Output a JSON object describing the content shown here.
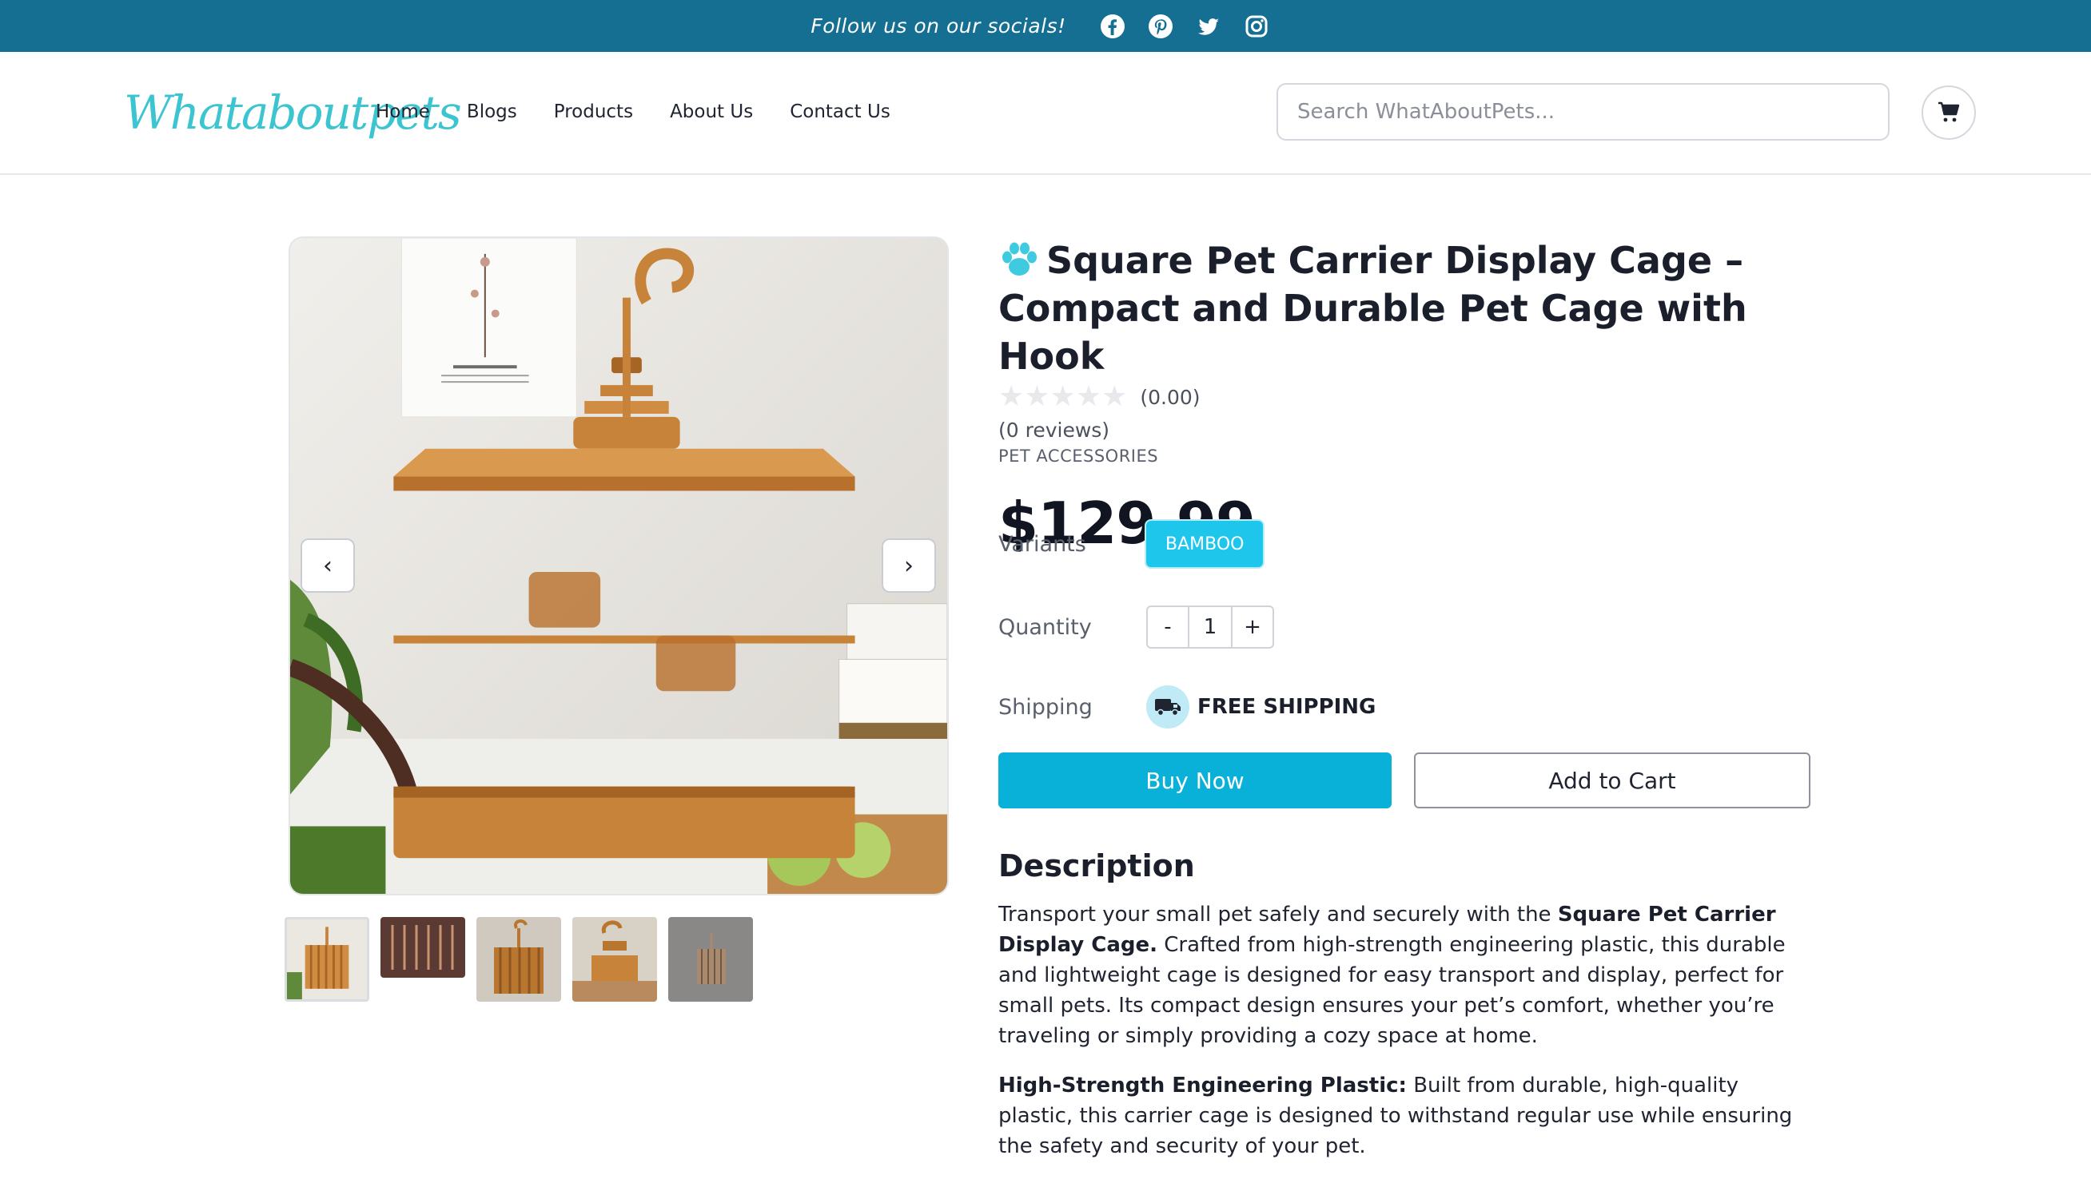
{
  "topbar": {
    "follow_text": "Follow us on our socials!",
    "icons": [
      "facebook-icon",
      "pinterest-icon",
      "twitter-icon",
      "instagram-icon"
    ]
  },
  "header": {
    "logo_text": "Whataboutpets",
    "nav": [
      "Home",
      "Blogs",
      "Products",
      "About Us",
      "Contact Us"
    ],
    "search_placeholder": "Search WhatAboutPets...",
    "cart_icon": "cart-icon"
  },
  "gallery": {
    "prev_label": "‹",
    "next_label": "›",
    "thumbnail_count": 5,
    "active_thumbnail": 1
  },
  "product": {
    "title": "Square Pet Carrier Display Cage – Compact and Durable Pet Cage with Hook",
    "stars": "★★★★★",
    "rating": "(0.00)",
    "reviews": "(0 reviews)",
    "category": "PET ACCESSORIES",
    "price": "$129.99",
    "variants_label": "Variants",
    "variant": "BAMBOO",
    "quantity_label": "Quantity",
    "qty_minus": "-",
    "quantity": "1",
    "qty_plus": "+",
    "shipping_label": "Shipping",
    "shipping_value": "FREE SHIPPING",
    "buy_now": "Buy Now",
    "add_to_cart": "Add to Cart"
  },
  "description": {
    "heading": "Description",
    "p1_pre": "Transport your small pet safely and securely with the ",
    "p1_bold": "Square Pet Carrier Display Cage.",
    "p1_post": " Crafted from high-strength engineering plastic, this durable and lightweight cage is designed for easy transport and display, perfect for small pets. Its compact design ensures your pet’s comfort, whether you’re traveling or simply providing a cozy space at home.",
    "p2_bold": "High-Strength Engineering Plastic:",
    "p2_post": " Built from durable, high-quality plastic, this carrier cage is designed to withstand regular use while ensuring the safety and security of your pet."
  },
  "colors": {
    "topbar": "#146f92",
    "accent": "#09b1d9",
    "variant": "#1fc6ec",
    "logo": "#3cc5d0",
    "cage": "#c8833a"
  }
}
